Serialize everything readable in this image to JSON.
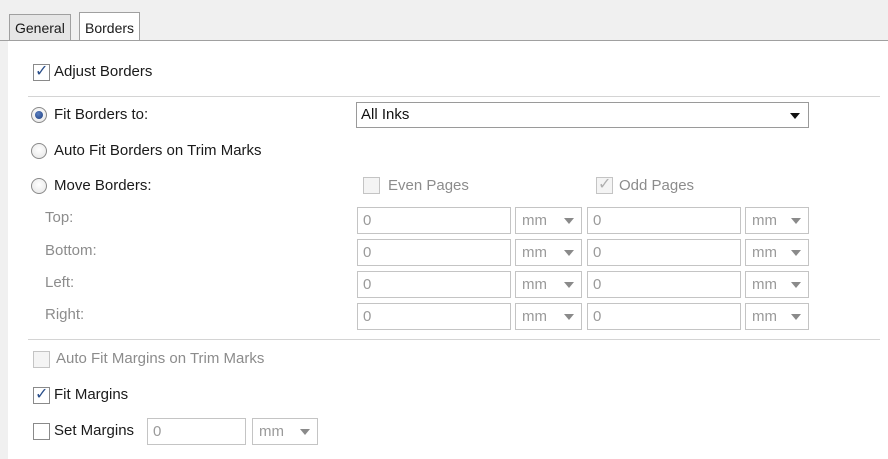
{
  "tabs": [
    {
      "label": "General",
      "active": false
    },
    {
      "label": "Borders",
      "active": true
    }
  ],
  "adjust_borders": {
    "label": "Adjust Borders",
    "checked": true
  },
  "fit_borders_to": {
    "label": "Fit Borders to:",
    "selected": true,
    "value": "All Inks"
  },
  "auto_fit_borders": {
    "label": "Auto Fit Borders on Trim Marks",
    "selected": false
  },
  "move_borders": {
    "label": "Move Borders:",
    "selected": false,
    "even_pages": {
      "label": "Even Pages",
      "checked": false
    },
    "odd_pages": {
      "label": "Odd Pages",
      "checked": true
    },
    "rows": [
      {
        "label": "Top:",
        "even_value": "0",
        "even_unit": "mm",
        "odd_value": "0",
        "odd_unit": "mm"
      },
      {
        "label": "Bottom:",
        "even_value": "0",
        "even_unit": "mm",
        "odd_value": "0",
        "odd_unit": "mm"
      },
      {
        "label": "Left:",
        "even_value": "0",
        "even_unit": "mm",
        "odd_value": "0",
        "odd_unit": "mm"
      },
      {
        "label": "Right:",
        "even_value": "0",
        "even_unit": "mm",
        "odd_value": "0",
        "odd_unit": "mm"
      }
    ]
  },
  "auto_fit_margins": {
    "label": "Auto Fit Margins on Trim Marks",
    "checked": false,
    "enabled": false
  },
  "fit_margins": {
    "label": "Fit Margins",
    "checked": true
  },
  "set_margins": {
    "label": "Set Margins",
    "checked": false,
    "value": "0",
    "unit": "mm"
  },
  "colors": {
    "accent": "#2b4f8a",
    "border": "#a0a0a0",
    "disabled_text": "#8c8c8c"
  }
}
